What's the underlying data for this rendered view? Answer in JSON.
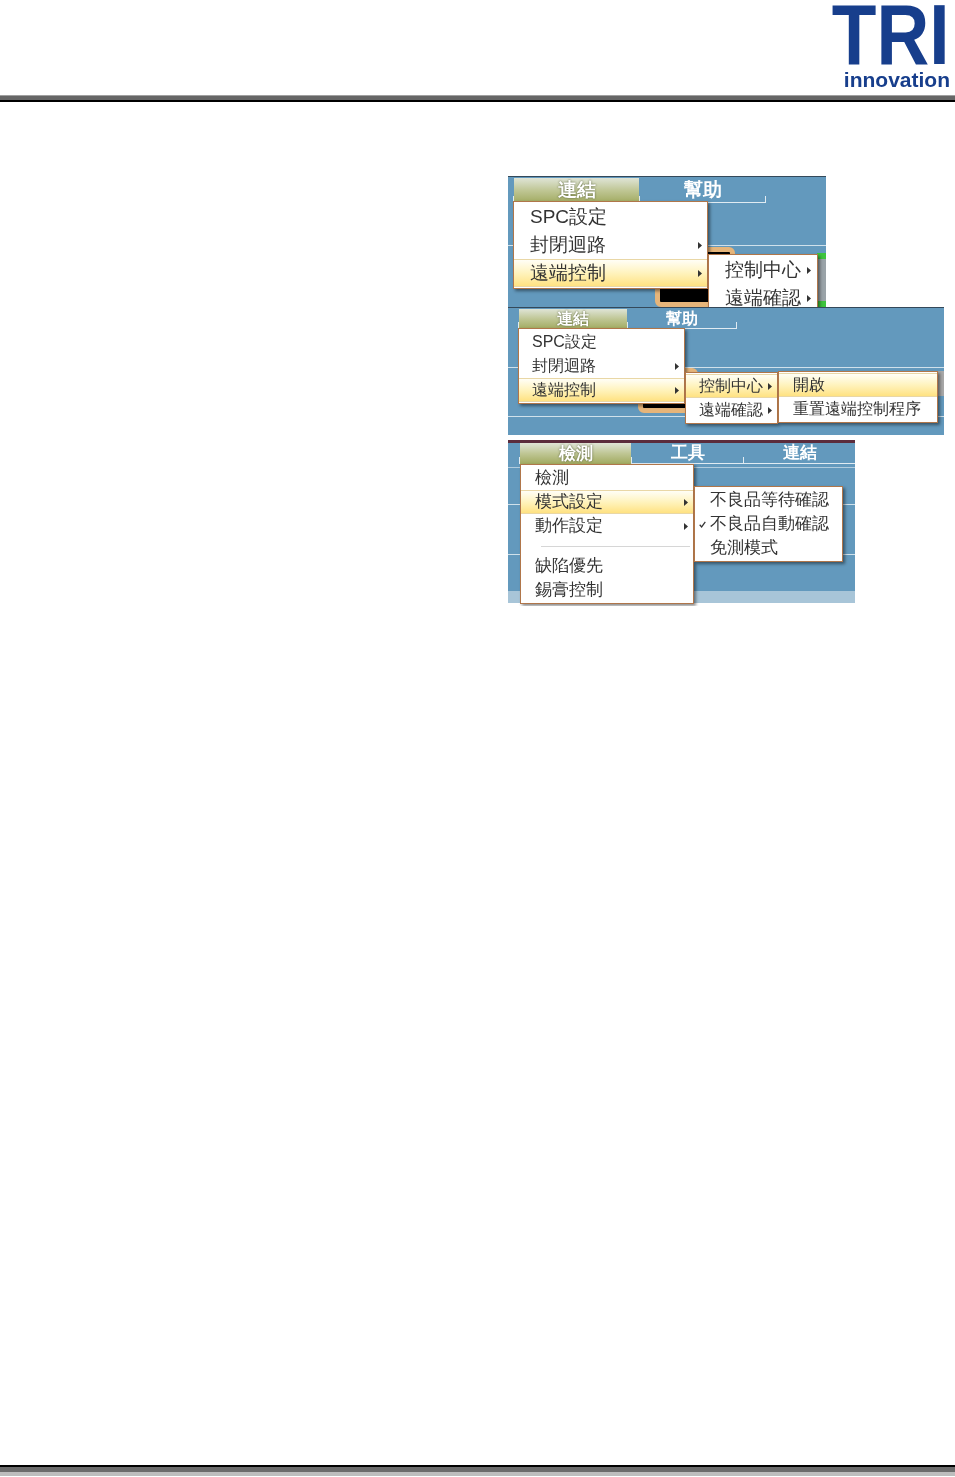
{
  "logo": {
    "wordmark": "TRI",
    "tagline": "innovation"
  },
  "screenshots": [
    {
      "menu_bar": [
        {
          "label": "連結",
          "selected": true
        },
        {
          "label": "幫助",
          "selected": false
        }
      ],
      "menus": [
        {
          "items": [
            {
              "label": "SPC設定",
              "submenu": false,
              "selected": false
            },
            {
              "label": "封閉迴路",
              "submenu": true,
              "selected": false
            },
            {
              "label": "遠端控制",
              "submenu": true,
              "selected": true
            }
          ]
        },
        {
          "items": [
            {
              "label": "控制中心",
              "submenu": true,
              "selected": false
            },
            {
              "label": "遠端確認",
              "submenu": true,
              "selected": false
            }
          ]
        }
      ]
    },
    {
      "menu_bar": [
        {
          "label": "連結",
          "selected": true
        },
        {
          "label": "幫助",
          "selected": false
        }
      ],
      "menus": [
        {
          "items": [
            {
              "label": "SPC設定",
              "submenu": false,
              "selected": false
            },
            {
              "label": "封閉迴路",
              "submenu": true,
              "selected": false
            },
            {
              "label": "遠端控制",
              "submenu": true,
              "selected": true
            }
          ]
        },
        {
          "items": [
            {
              "label": "控制中心",
              "submenu": true,
              "selected": true
            },
            {
              "label": "遠端確認",
              "submenu": true,
              "selected": false
            }
          ]
        },
        {
          "items": [
            {
              "label": "開啟",
              "submenu": false,
              "selected": true
            },
            {
              "label": "重置遠端控制程序",
              "submenu": false,
              "selected": false
            }
          ]
        }
      ]
    },
    {
      "menu_bar": [
        {
          "label": "檢測",
          "selected": true
        },
        {
          "label": "工具",
          "selected": false
        },
        {
          "label": "連結",
          "selected": false
        }
      ],
      "menus": [
        {
          "items": [
            {
              "kind": "item",
              "label": "檢測",
              "submenu": false,
              "selected": false
            },
            {
              "kind": "item",
              "label": "模式設定",
              "submenu": true,
              "selected": true
            },
            {
              "kind": "item",
              "label": "動作設定",
              "submenu": true,
              "selected": false
            },
            {
              "kind": "separator"
            },
            {
              "kind": "item",
              "label": "缺陷優先",
              "submenu": false,
              "selected": false
            },
            {
              "kind": "item",
              "label": "錫膏控制",
              "submenu": false,
              "selected": false
            }
          ]
        },
        {
          "items": [
            {
              "label": "不良品等待確認",
              "checked": false,
              "selected": false
            },
            {
              "label": "不良品自動確認",
              "checked": true,
              "selected": false
            },
            {
              "label": "免測模式",
              "checked": false,
              "selected": false
            }
          ]
        }
      ]
    }
  ]
}
